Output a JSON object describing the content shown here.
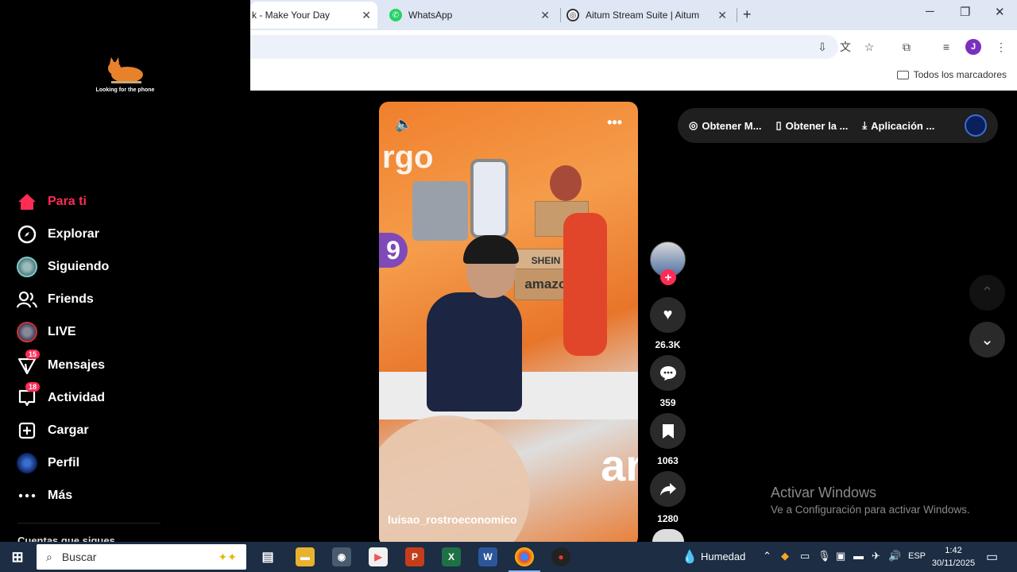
{
  "browser": {
    "tabs": [
      {
        "title": "k - Make Your Day",
        "active": true
      },
      {
        "title": "WhatsApp",
        "active": false,
        "icon": "whatsapp-icon"
      },
      {
        "title": "Aitum Stream Suite | Aitum",
        "active": false,
        "icon": "aitum-icon"
      }
    ],
    "close_glyph": "✕",
    "new_tab_glyph": "+",
    "profile_initial": "J",
    "bookmarks_all": "Todos los marcadores"
  },
  "sidebar": {
    "logo_caption": "Looking for the phone",
    "items": [
      {
        "label": "Para ti",
        "icon": "home-icon",
        "active": true
      },
      {
        "label": "Explorar",
        "icon": "compass-icon"
      },
      {
        "label": "Siguiendo",
        "icon": "avatar-icon"
      },
      {
        "label": "Friends",
        "icon": "friends-icon"
      },
      {
        "label": "LIVE",
        "icon": "live-avatar-icon"
      },
      {
        "label": "Mensajes",
        "icon": "messages-icon",
        "badge": "15"
      },
      {
        "label": "Actividad",
        "icon": "activity-icon",
        "badge": "18"
      },
      {
        "label": "Cargar",
        "icon": "upload-icon"
      },
      {
        "label": "Perfil",
        "icon": "profile-avatar-icon"
      },
      {
        "label": "Más",
        "icon": "more-icon"
      }
    ],
    "following_title": "Cuentas que sigues"
  },
  "video": {
    "author": "luisao_rostroeconomico",
    "wall_text_top": "rgo",
    "wall_text_bottom": "ar",
    "box1": "SHEIN",
    "box2": "amazon"
  },
  "actions": {
    "likes": "26.3K",
    "comments": "359",
    "saves": "1063",
    "shares": "1280"
  },
  "top_pills": [
    {
      "label": "Obtener M...",
      "icon": "coin-icon"
    },
    {
      "label": "Obtener la ...",
      "icon": "phone-icon"
    },
    {
      "label": "Aplicación ...",
      "icon": "download-icon"
    }
  ],
  "windows_notice": {
    "title": "Activar Windows",
    "subtitle": "Ve a Configuración para activar Windows."
  },
  "taskbar": {
    "search_placeholder": "Buscar",
    "weather": "Humedad",
    "language": "ESP",
    "time": "1:42",
    "date": "30/11/2025"
  },
  "colors": {
    "accent": "#fe2c55",
    "taskbar": "#1c2d44",
    "tabstrip": "#dfe7f5"
  }
}
